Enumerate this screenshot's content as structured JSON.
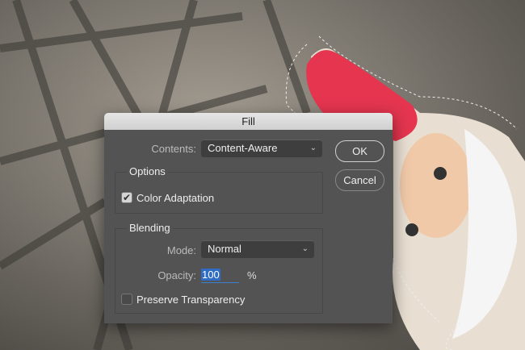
{
  "dialog": {
    "title": "Fill",
    "contents_label": "Contents:",
    "contents_value": "Content-Aware",
    "ok_label": "OK",
    "cancel_label": "Cancel",
    "options_title": "Options",
    "color_adaptation_label": "Color Adaptation",
    "color_adaptation_checked": true,
    "blending_title": "Blending",
    "mode_label": "Mode:",
    "mode_value": "Normal",
    "opacity_label": "Opacity:",
    "opacity_value": "100",
    "opacity_unit": "%",
    "preserve_transparency_label": "Preserve Transparency",
    "preserve_transparency_checked": false
  },
  "icons": {
    "dropdown": "chevron-down-icon",
    "check": "checkmark-icon"
  }
}
